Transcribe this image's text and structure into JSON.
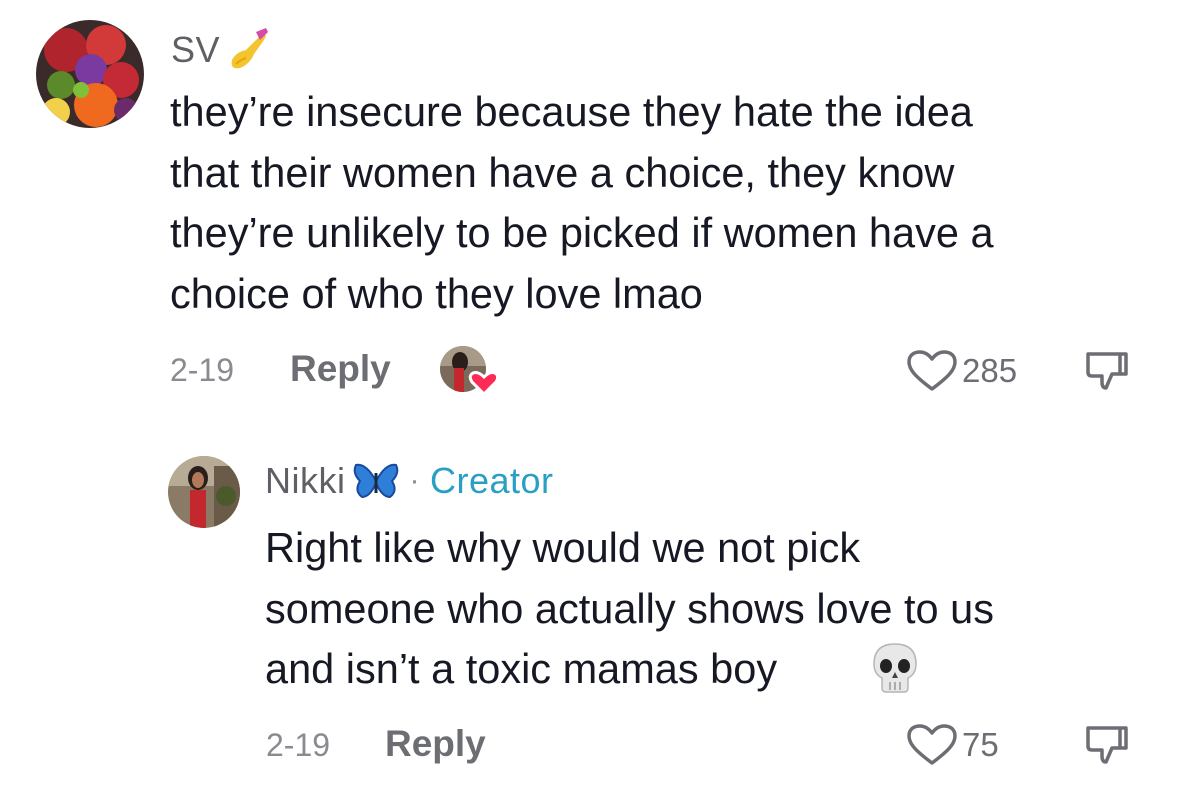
{
  "comments": [
    {
      "username": "SV",
      "username_emoji": "nail-polish-icon",
      "text_lines": [
        "they’re insecure because they hate the idea",
        "that their women have a choice, they know",
        "they’re unlikely to be picked if women have a",
        "choice of who they love lmao"
      ],
      "date": "2-19",
      "reply_label": "Reply",
      "creator_liked": true,
      "likes": "285"
    },
    {
      "username": "Nikki",
      "username_emoji": "butterfly-icon",
      "separator": "·",
      "badge": "Creator",
      "text_lines": [
        "Right like why would we not pick",
        "someone who actually shows love to us",
        "and isn’t a toxic mamas boy"
      ],
      "trailing_emoji": "skull-icon",
      "date": "2-19",
      "reply_label": "Reply",
      "likes": "75"
    }
  ],
  "colors": {
    "text": "#161823",
    "secondary": "#8a8b91",
    "creator_badge": "#2a9fc4",
    "heart_badge": "#fe2c55"
  }
}
